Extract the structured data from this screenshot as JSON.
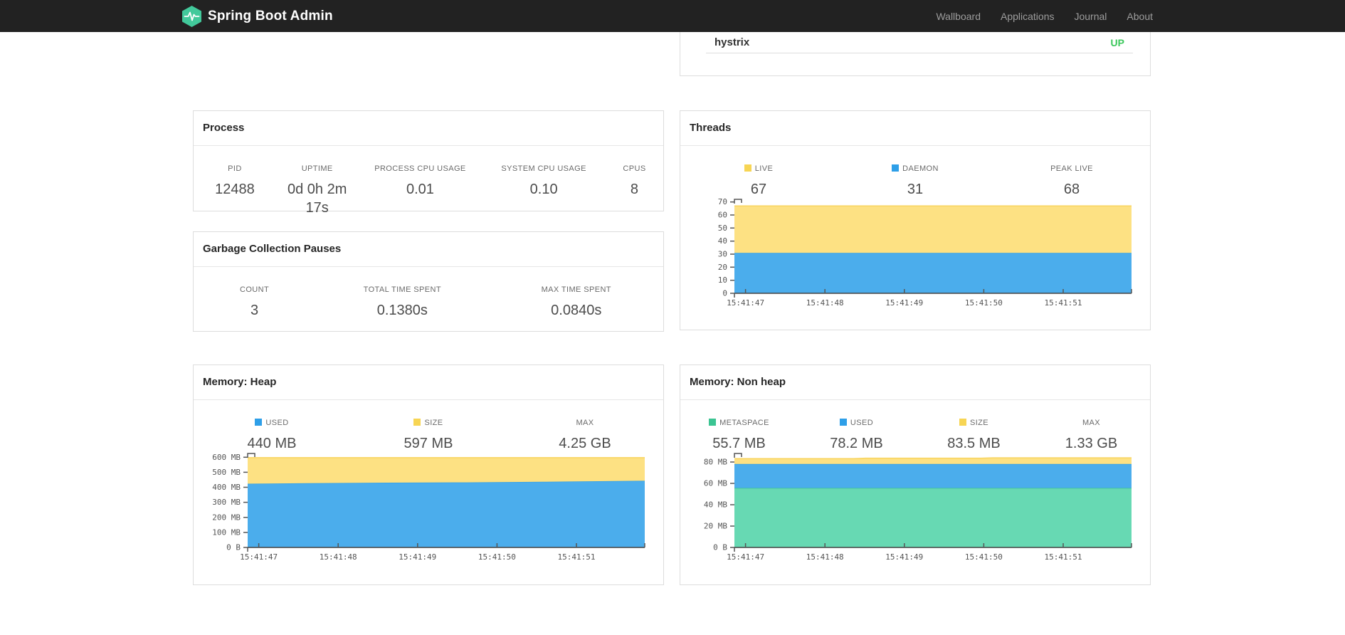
{
  "navbar": {
    "brand": "Spring Boot Admin",
    "brand_color": "#42c99b",
    "items": [
      {
        "label": "Wallboard"
      },
      {
        "label": "Applications"
      },
      {
        "label": "Journal"
      },
      {
        "label": "About"
      }
    ]
  },
  "application_row": {
    "name": "hystrix",
    "status": "UP",
    "status_color": "#3cc85c"
  },
  "panels": {
    "process": {
      "title": "Process",
      "metrics": [
        {
          "label": "PID",
          "value": "12488"
        },
        {
          "label": "UPTIME",
          "value": "0d 0h 2m 17s"
        },
        {
          "label": "PROCESS CPU USAGE",
          "value": "0.01"
        },
        {
          "label": "SYSTEM CPU USAGE",
          "value": "0.10"
        },
        {
          "label": "CPUS",
          "value": "8"
        }
      ]
    },
    "gc": {
      "title": "Garbage Collection Pauses",
      "metrics": [
        {
          "label": "COUNT",
          "value": "3"
        },
        {
          "label": "TOTAL TIME SPENT",
          "value": "0.1380s"
        },
        {
          "label": "MAX TIME SPENT",
          "value": "0.0840s"
        }
      ]
    },
    "threads": {
      "title": "Threads",
      "metrics": [
        {
          "label": "LIVE",
          "value": "67",
          "swatch": "#f7d554"
        },
        {
          "label": "DAEMON",
          "value": "31",
          "swatch": "#2e9fe8"
        },
        {
          "label": "PEAK LIVE",
          "value": "68"
        }
      ]
    },
    "heap": {
      "title": "Memory: Heap",
      "metrics": [
        {
          "label": "USED",
          "value": "440 MB",
          "swatch": "#2e9fe8"
        },
        {
          "label": "SIZE",
          "value": "597 MB",
          "swatch": "#f7d554"
        },
        {
          "label": "MAX",
          "value": "4.25 GB"
        }
      ]
    },
    "nonheap": {
      "title": "Memory: Non heap",
      "metrics": [
        {
          "label": "METASPACE",
          "value": "55.7 MB",
          "swatch": "#3bc492"
        },
        {
          "label": "USED",
          "value": "78.2 MB",
          "swatch": "#2e9fe8"
        },
        {
          "label": "SIZE",
          "value": "83.5 MB",
          "swatch": "#f7d554"
        },
        {
          "label": "MAX",
          "value": "1.33 GB"
        }
      ]
    }
  },
  "chart_data": [
    {
      "id": "threads",
      "type": "area",
      "stacked": true,
      "title": "Threads",
      "legend_position": "above",
      "grid": false,
      "ylim": [
        0,
        72
      ],
      "y_ticks": [
        {
          "v": 0,
          "label": "0"
        },
        {
          "v": 10,
          "label": "10"
        },
        {
          "v": 20,
          "label": "20"
        },
        {
          "v": 30,
          "label": "30"
        },
        {
          "v": 40,
          "label": "40"
        },
        {
          "v": 50,
          "label": "50"
        },
        {
          "v": 60,
          "label": "60"
        },
        {
          "v": 70,
          "label": "70"
        }
      ],
      "x_ticks": [
        "15:41:47",
        "15:41:48",
        "15:41:49",
        "15:41:50",
        "15:41:51"
      ],
      "x_tick_fracs": [
        0.028,
        0.228,
        0.428,
        0.628,
        0.828
      ],
      "series": [
        {
          "name": "DAEMON",
          "color": "#2f9fe9",
          "fill": "#4badec",
          "points": [
            [
              0,
              31
            ],
            [
              1,
              31
            ]
          ]
        },
        {
          "name": "LIVE",
          "color": "#f8d45e",
          "fill": "#fde183",
          "points": [
            [
              0,
              67
            ],
            [
              1,
              67
            ]
          ]
        }
      ],
      "summary": {
        "LIVE": 67,
        "DAEMON": 31,
        "PEAK LIVE": 68
      }
    },
    {
      "id": "heap",
      "type": "area",
      "stacked": true,
      "title": "Memory: Heap",
      "legend_position": "above",
      "grid": false,
      "ylim": [
        0,
        625
      ],
      "y_ticks": [
        {
          "v": 0,
          "label": "0 B"
        },
        {
          "v": 100,
          "label": "100 MB"
        },
        {
          "v": 200,
          "label": "200 MB"
        },
        {
          "v": 300,
          "label": "300 MB"
        },
        {
          "v": 400,
          "label": "400 MB"
        },
        {
          "v": 500,
          "label": "500 MB"
        },
        {
          "v": 600,
          "label": "600 MB"
        }
      ],
      "x_ticks": [
        "15:41:47",
        "15:41:48",
        "15:41:49",
        "15:41:50",
        "15:41:51"
      ],
      "x_tick_fracs": [
        0.028,
        0.228,
        0.428,
        0.628,
        0.828
      ],
      "series": [
        {
          "name": "USED",
          "color": "#2f9fe9",
          "fill": "#4badec",
          "points": [
            [
              0,
              424
            ],
            [
              0.15,
              427
            ],
            [
              0.35,
              431
            ],
            [
              0.55,
              433
            ],
            [
              0.75,
              437
            ],
            [
              1,
              443
            ]
          ]
        },
        {
          "name": "SIZE",
          "color": "#f8d45e",
          "fill": "#fde183",
          "points": [
            [
              0,
              597
            ],
            [
              1,
              597
            ]
          ]
        }
      ],
      "summary": {
        "USED": "440 MB",
        "SIZE": "597 MB",
        "MAX": "4.25 GB"
      }
    },
    {
      "id": "nonheap",
      "type": "area",
      "stacked": true,
      "title": "Memory: Non heap",
      "legend_position": "above",
      "grid": false,
      "ylim": [
        0,
        88
      ],
      "y_ticks": [
        {
          "v": 0,
          "label": "0 B"
        },
        {
          "v": 20,
          "label": "20 MB"
        },
        {
          "v": 40,
          "label": "40 MB"
        },
        {
          "v": 60,
          "label": "60 MB"
        },
        {
          "v": 80,
          "label": "80 MB"
        }
      ],
      "x_ticks": [
        "15:41:47",
        "15:41:48",
        "15:41:49",
        "15:41:50",
        "15:41:51"
      ],
      "x_tick_fracs": [
        0.028,
        0.228,
        0.428,
        0.628,
        0.828
      ],
      "series": [
        {
          "name": "METASPACE",
          "color": "#3cc492",
          "fill": "#67d9b3",
          "points": [
            [
              0,
              55.7
            ],
            [
              1,
              55.7
            ]
          ]
        },
        {
          "name": "USED",
          "color": "#2f9fe9",
          "fill": "#4badec",
          "points": [
            [
              0,
              78.2
            ],
            [
              1,
              78.2
            ]
          ]
        },
        {
          "name": "SIZE",
          "color": "#f8d45e",
          "fill": "#fde183",
          "points": [
            [
              0,
              83.2
            ],
            [
              0.3,
              83.2
            ],
            [
              0.33,
              83.6
            ],
            [
              0.62,
              83.6
            ],
            [
              0.65,
              83.9
            ],
            [
              1,
              83.9
            ]
          ]
        }
      ],
      "summary": {
        "METASPACE": "55.7 MB",
        "USED": "78.2 MB",
        "SIZE": "83.5 MB",
        "MAX": "1.33 GB"
      }
    }
  ]
}
